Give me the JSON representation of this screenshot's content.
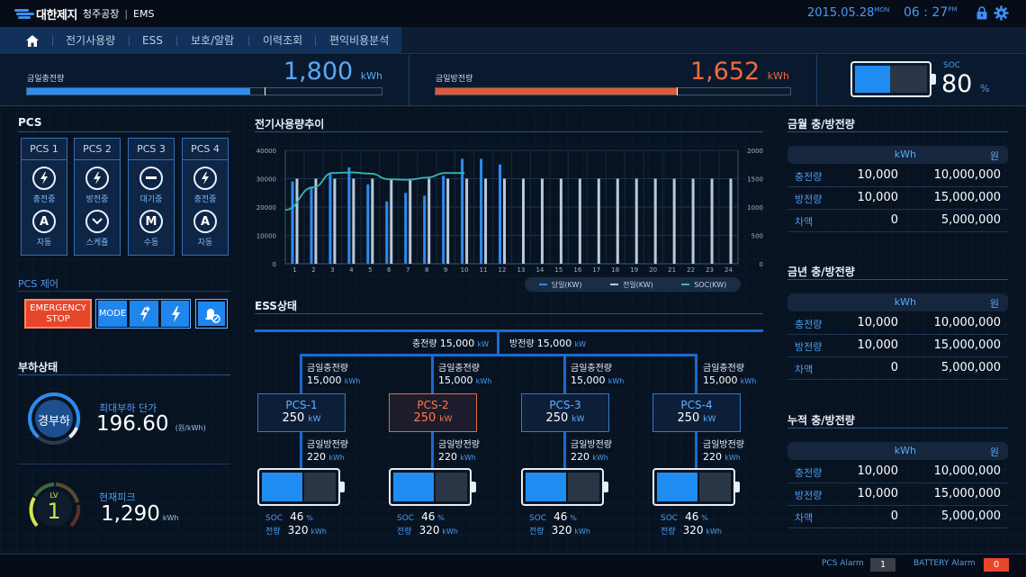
{
  "header": {
    "brand": "대한제지",
    "plant": "청주공장",
    "system": "EMS",
    "date": "2015.05.28",
    "weekday": "MON",
    "time": "06 : 27",
    "meridiem": "PM"
  },
  "nav": {
    "items": [
      "전기사용량",
      "ESS",
      "보호/알람",
      "이력조회",
      "편익비용분석"
    ]
  },
  "summary": {
    "charge": {
      "label": "금일충전량",
      "value": "1,800",
      "unit": "kWh",
      "fill": 0.63,
      "marker": 0.67
    },
    "discharge": {
      "label": "금일방전량",
      "value": "1,652",
      "unit": "kWh",
      "fill": 0.68,
      "marker": 0.68
    },
    "soc": {
      "label": "SOC",
      "value": "80",
      "unit": "%",
      "fill": 0.48
    }
  },
  "pcs": {
    "title": "PCS",
    "cards": [
      {
        "name": "PCS 1",
        "state": "충전중",
        "state_icon": "bolt-icon",
        "mode": "자동",
        "mode_letter": "A"
      },
      {
        "name": "PCS 2",
        "state": "방전중",
        "state_icon": "bolt-icon",
        "mode": "스케쥴",
        "mode_letter": "chevron"
      },
      {
        "name": "PCS 3",
        "state": "대기중",
        "state_icon": "minus-icon",
        "mode": "수동",
        "mode_letter": "M"
      },
      {
        "name": "PCS 4",
        "state": "충전중",
        "state_icon": "bolt-icon",
        "mode": "자동",
        "mode_letter": "A"
      }
    ],
    "control_label": "PCS 제어",
    "emergency": "EMERGENCY STOP",
    "mode": "MODE"
  },
  "load": {
    "title": "부하상태",
    "gauge1": {
      "label": "경부하"
    },
    "max_label": "최대부하 단가",
    "max_value": "196.60",
    "max_unit": "(원/kWh)",
    "gauge2": {
      "label_top": "LV",
      "label": "1"
    },
    "peak_label": "현재피크",
    "peak_value": "1,290",
    "peak_unit": "kWh"
  },
  "chart_data": {
    "type": "bar",
    "title": "전기사용량추이",
    "x": [
      "1",
      "2",
      "3",
      "4",
      "5",
      "6",
      "7",
      "8",
      "9",
      "10",
      "11",
      "12",
      "13",
      "14",
      "15",
      "16",
      "17",
      "18",
      "19",
      "20",
      "21",
      "22",
      "23",
      "24"
    ],
    "ylim": [
      0,
      40000
    ],
    "y_ticks": [
      "0",
      "10000",
      "20000",
      "30000",
      "40000"
    ],
    "y2lim": [
      0,
      2000
    ],
    "y2_ticks": [
      "0",
      "500",
      "1000",
      "1500",
      "2000"
    ],
    "grid": true,
    "legend_position": "bottom-right",
    "series": [
      {
        "name": "당일(KW)",
        "type": "bar",
        "color": "#2e8cf0",
        "values": [
          29000,
          27000,
          32000,
          34000,
          28000,
          22000,
          25000,
          24000,
          31000,
          37000,
          37000,
          35000,
          null,
          null,
          null,
          null,
          null,
          null,
          null,
          null,
          null,
          null,
          null,
          null
        ]
      },
      {
        "name": "전일(KW)",
        "type": "bar",
        "color": "#b9c9dc",
        "values": [
          30000,
          30000,
          30000,
          30000,
          30000,
          30000,
          30000,
          30000,
          30000,
          30000,
          30000,
          30000,
          30000,
          30000,
          30000,
          30000,
          30000,
          30000,
          30000,
          30000,
          30000,
          30000,
          30000,
          30000
        ]
      },
      {
        "name": "SOC(KW)",
        "type": "line",
        "color": "#32b8b0",
        "axis": "right",
        "values": [
          950,
          1350,
          1600,
          1610,
          1590,
          1490,
          1480,
          1520,
          1600,
          1600
        ]
      }
    ]
  },
  "ess": {
    "title": "ESS상태",
    "total_charge": {
      "label": "충전량",
      "value": "15,000",
      "unit": "kW"
    },
    "total_discharge": {
      "label": "방전량",
      "value": "15,000",
      "unit": "kW"
    },
    "units": [
      {
        "charge_label": "금일충전량",
        "charge": "15,000",
        "charge_unit": "kWh",
        "pcs": "PCS-1",
        "power": "250",
        "power_unit": "kW",
        "alert": false,
        "discharge_label": "금일방전량",
        "discharge": "220",
        "discharge_unit": "kWh",
        "soc_label": "SOC",
        "soc": "46",
        "soc_unit": "%",
        "energy_label": "전량",
        "energy": "320",
        "energy_unit": "kWh",
        "fill": 0.55
      },
      {
        "charge_label": "금일충전량",
        "charge": "15,000",
        "charge_unit": "kWh",
        "pcs": "PCS-2",
        "power": "250",
        "power_unit": "kW",
        "alert": true,
        "discharge_label": "금일방전량",
        "discharge": "220",
        "discharge_unit": "kWh",
        "soc_label": "SOC",
        "soc": "46",
        "soc_unit": "%",
        "energy_label": "전량",
        "energy": "320",
        "energy_unit": "kWh",
        "fill": 0.55
      },
      {
        "charge_label": "금일충전량",
        "charge": "15,000",
        "charge_unit": "kWh",
        "pcs": "PCS-3",
        "power": "250",
        "power_unit": "kW",
        "alert": false,
        "discharge_label": "금일방전량",
        "discharge": "220",
        "discharge_unit": "kWh",
        "soc_label": "SOC",
        "soc": "46",
        "soc_unit": "%",
        "energy_label": "전량",
        "energy": "320",
        "energy_unit": "kWh",
        "fill": 0.55
      },
      {
        "charge_label": "금일충전량",
        "charge": "15,000",
        "charge_unit": "kWh",
        "pcs": "PCS-4",
        "power": "250",
        "power_unit": "kW",
        "alert": false,
        "discharge_label": "금일방전량",
        "discharge": "220",
        "discharge_unit": "kWh",
        "soc_label": "SOC",
        "soc": "46",
        "soc_unit": "%",
        "energy_label": "전량",
        "energy": "320",
        "energy_unit": "kWh",
        "fill": 0.55
      }
    ]
  },
  "tables": [
    {
      "title": "금월 충/방전량",
      "col1": "kWh",
      "col2": "원",
      "rows": [
        {
          "label": "충전량",
          "kwh": "10,000",
          "won": "10,000,000"
        },
        {
          "label": "방전량",
          "kwh": "10,000",
          "won": "15,000,000"
        },
        {
          "label": "차액",
          "kwh": "0",
          "won": "5,000,000"
        }
      ]
    },
    {
      "title": "금년 충/방전량",
      "col1": "kWh",
      "col2": "원",
      "rows": [
        {
          "label": "충전량",
          "kwh": "10,000",
          "won": "10,000,000"
        },
        {
          "label": "방전량",
          "kwh": "10,000",
          "won": "15,000,000"
        },
        {
          "label": "차액",
          "kwh": "0",
          "won": "5,000,000"
        }
      ]
    },
    {
      "title": "누적 충/방전량",
      "col1": "kWh",
      "col2": "원",
      "rows": [
        {
          "label": "충전량",
          "kwh": "10,000",
          "won": "10,000,000"
        },
        {
          "label": "방전량",
          "kwh": "10,000",
          "won": "15,000,000"
        },
        {
          "label": "차액",
          "kwh": "0",
          "won": "5,000,000"
        }
      ]
    }
  ],
  "footer": {
    "pcs_alarm_label": "PCS Alarm",
    "pcs_alarm": "1",
    "battery_alarm_label": "BATTERY Alarm",
    "battery_alarm": "0"
  },
  "colors": {
    "accent": "#2e8cf0",
    "alert": "#e8462b",
    "soc_line": "#32b8b0"
  }
}
